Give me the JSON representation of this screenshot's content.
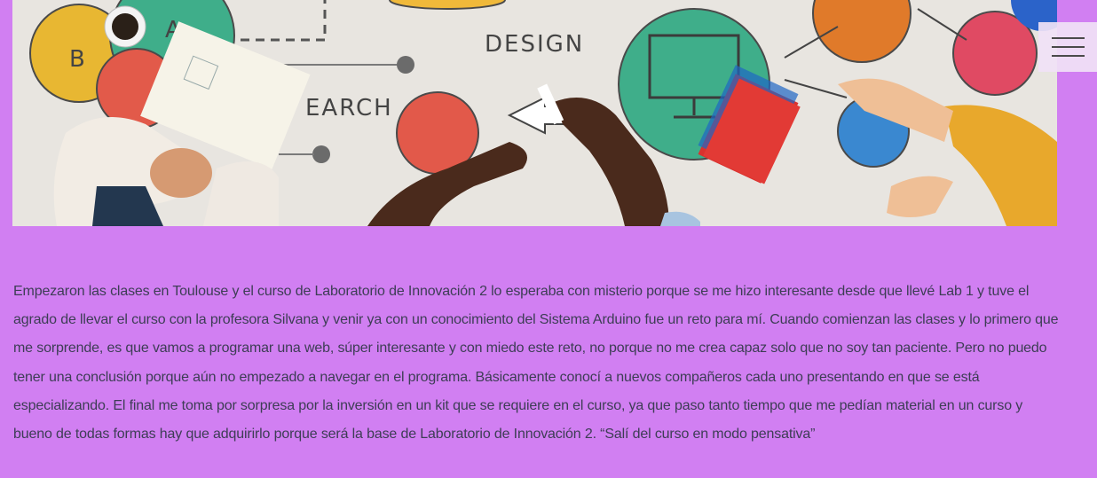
{
  "hero": {
    "words": [
      "DESIGN",
      "EARCH",
      "B",
      "A"
    ]
  },
  "menu": {
    "icon": "hamburger-menu-icon"
  },
  "article": {
    "paragraph": "Empezaron las clases en Toulouse y el curso de Laboratorio de Innovación 2 lo esperaba con misterio porque se me hizo interesante desde que llevé Lab 1 y tuve el agrado de llevar el curso con la profesora Silvana y venir ya con un conocimiento del Sistema Arduino fue un reto para mí. Cuando comienzan las clases y lo primero que me sorprende, es que vamos a programar una web, súper interesante y con miedo este reto, no porque no me crea capaz solo que no soy tan paciente. Pero no puedo tener una conclusión porque aún no empezado a navegar en el programa. Básicamente conocí a nuevos compañeros cada uno presentando en que se está especializando. El final me toma por sorpresa por la inversión en un kit que se requiere en el curso, ya que paso tanto tiempo que me pedían material en un curso y bueno de todas formas hay que adquirirlo porque será la base de Laboratorio de Innovación 2. “Salí del curso en modo pensativa”"
  },
  "colors": {
    "page_background": "#d17ff2",
    "text": "#3d3d55",
    "menu_background": "#f0e2f6"
  }
}
